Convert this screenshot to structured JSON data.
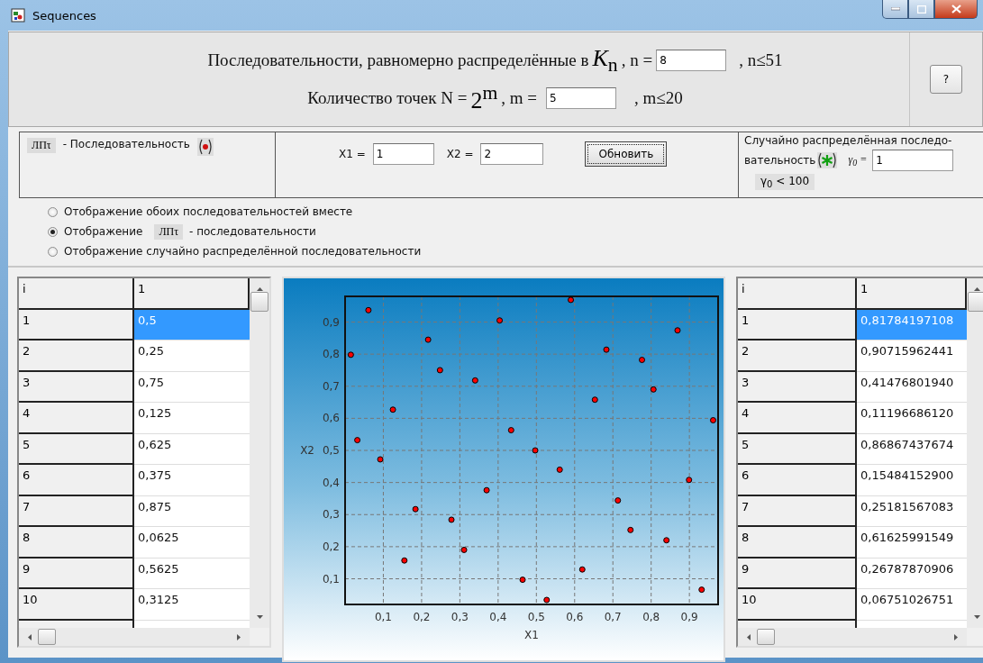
{
  "window": {
    "title": "Sequences"
  },
  "header": {
    "line_1": {
      "text": "Последовательности, равномерно распределённые в",
      "formula": "*K*$_{n}$",
      "label": ", n =",
      "value": "8",
      "limit": ", n≤51"
    },
    "line_2": {
      "text": "Количество точек N =",
      "formula": "2$^{m}$",
      "label": ", m =",
      "value": "5",
      "limit": ", m≤20"
    },
    "help_button": "?"
  },
  "sequence_panel": {
    "badge": "ЛПτ",
    "label": "- Последовательность"
  },
  "coordinates_panel": {
    "x1_label": "X1 =",
    "x1_value": "1",
    "x2_label": "X2 =",
    "x2_value": "2",
    "update_button": "Обновить"
  },
  "random_panel": {
    "line_1": "Случайно распределённая последо-",
    "line_2": "вательность",
    "gamma_label": "γ$_{0}$ =",
    "gamma_value": "1",
    "gamma_limit": "γ$_{0}$ < 100"
  },
  "display_options": [
    {
      "kind": "plain",
      "label": "Отображение обоих последовательностей вместе",
      "selected": false
    },
    {
      "kind": "badge",
      "label": "Отображение",
      "badge": "ЛПτ",
      "suffix": "- последовательности",
      "selected": true
    },
    {
      "kind": "plain",
      "label": "Отображение случайно распределённой последовательности",
      "selected": false
    }
  ],
  "left_table": {
    "columns": [
      "i",
      "1"
    ],
    "rows": [
      {
        "i": "1",
        "value": "0,5",
        "selected": true
      },
      {
        "i": "2",
        "value": "0,25",
        "selected": false
      },
      {
        "i": "3",
        "value": "0,75",
        "selected": false
      },
      {
        "i": "4",
        "value": "0,125",
        "selected": false
      },
      {
        "i": "5",
        "value": "0,625",
        "selected": false
      },
      {
        "i": "6",
        "value": "0,375",
        "selected": false
      },
      {
        "i": "7",
        "value": "0,875",
        "selected": false
      },
      {
        "i": "8",
        "value": "0,0625",
        "selected": false
      },
      {
        "i": "9",
        "value": "0,5625",
        "selected": false
      },
      {
        "i": "10",
        "value": "0,3125",
        "selected": false
      }
    ]
  },
  "chart": {
    "chart_data": {
      "type": "scatter",
      "grid": true,
      "xlabel": "X1",
      "ylabel": "X2",
      "xlim": [
        0,
        0.975
      ],
      "ylim": [
        0.02,
        0.98
      ],
      "xticks": [
        {
          "value": 0.1,
          "label": "0,1"
        },
        {
          "value": 0.2,
          "label": "0,2"
        },
        {
          "value": 0.3,
          "label": "0,3"
        },
        {
          "value": 0.4,
          "label": "0,4"
        },
        {
          "value": 0.5,
          "label": "0,5"
        },
        {
          "value": 0.6,
          "label": "0,6"
        },
        {
          "value": 0.7,
          "label": "0,7"
        },
        {
          "value": 0.8,
          "label": "0,8"
        },
        {
          "value": 0.9,
          "label": "0,9"
        }
      ],
      "yticks": [
        {
          "value": 0.1,
          "label": "0,1"
        },
        {
          "value": 0.2,
          "label": "0,2"
        },
        {
          "value": 0.3,
          "label": "0,3"
        },
        {
          "value": 0.4,
          "label": "0,4"
        },
        {
          "value": 0.5,
          "label": "0,5"
        },
        {
          "value": 0.6,
          "label": "0,6"
        },
        {
          "value": 0.7,
          "label": "0,7"
        },
        {
          "value": 0.8,
          "label": "0,8"
        },
        {
          "value": 0.9,
          "label": "0,9"
        }
      ],
      "series": [
        {
          "color": "#ff0000",
          "x": [
            0.015,
            0.032,
            0.061,
            0.092,
            0.125,
            0.155,
            0.184,
            0.217,
            0.248,
            0.278,
            0.311,
            0.34,
            0.37,
            0.404,
            0.434,
            0.464,
            0.497,
            0.527,
            0.561,
            0.59,
            0.62,
            0.653,
            0.683,
            0.713,
            0.746,
            0.776,
            0.806,
            0.84,
            0.869,
            0.899,
            0.932,
            0.962
          ],
          "values": [
            0.798,
            0.532,
            0.937,
            0.472,
            0.627,
            0.157,
            0.317,
            0.845,
            0.75,
            0.284,
            0.19,
            0.718,
            0.376,
            0.905,
            0.563,
            0.097,
            0.5,
            0.034,
            0.44,
            0.969,
            0.129,
            0.658,
            0.814,
            0.344,
            0.252,
            0.782,
            0.69,
            0.22,
            0.874,
            0.408,
            0.066,
            0.594
          ]
        }
      ]
    }
  },
  "right_table": {
    "columns": [
      "i",
      "1"
    ],
    "rows": [
      {
        "i": "1",
        "value": "0,81784197108",
        "selected": true
      },
      {
        "i": "2",
        "value": "0,90715962441",
        "selected": false
      },
      {
        "i": "3",
        "value": "0,41476801940",
        "selected": false
      },
      {
        "i": "4",
        "value": "0,11196686120",
        "selected": false
      },
      {
        "i": "5",
        "value": "0,86867437674",
        "selected": false
      },
      {
        "i": "6",
        "value": "0,15484152900",
        "selected": false
      },
      {
        "i": "7",
        "value": "0,25181567083",
        "selected": false
      },
      {
        "i": "8",
        "value": "0,61625991549",
        "selected": false
      },
      {
        "i": "9",
        "value": "0,26787870906",
        "selected": false
      },
      {
        "i": "10",
        "value": "0,06751026751",
        "selected": false
      }
    ]
  }
}
